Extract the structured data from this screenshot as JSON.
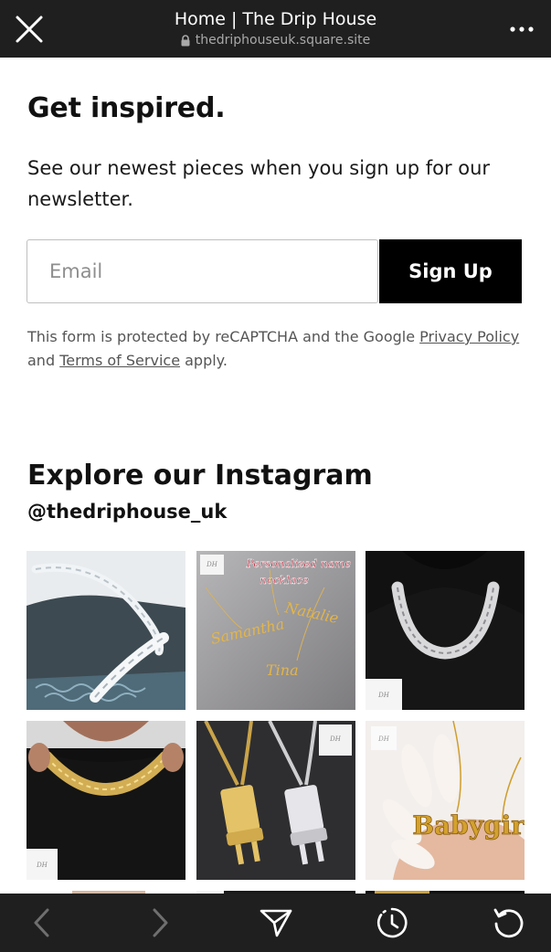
{
  "browser": {
    "title": "Home | The Drip House",
    "url": "thedriphouseuk.square.site",
    "icons": {
      "close": "close-icon",
      "lock": "lock-icon",
      "more": "more-icon"
    }
  },
  "newsletter": {
    "heading": "Get inspired.",
    "description": "See our newest pieces when you sign up for our newsletter.",
    "email_placeholder": "Email",
    "email_value": "",
    "signup_label": "Sign Up",
    "legal": {
      "prefix": "This form is protected by reCAPTCHA and the Google ",
      "privacy_link": "Privacy Policy",
      "middle": " and ",
      "terms_link": "Terms of Service",
      "suffix": " apply."
    }
  },
  "instagram": {
    "heading": "Explore our Instagram",
    "handle": "@thedriphouse_uk",
    "posts": [
      {
        "name": "silver-cuban-chain-post"
      },
      {
        "name": "personalized-name-necklace-post",
        "caption": "Personalized name necklace",
        "names": [
          "Samantha",
          "Natalie",
          "Tina"
        ],
        "watermark": "DH"
      },
      {
        "name": "iced-cuban-chain-bust-post",
        "watermark": "DH"
      },
      {
        "name": "gold-chain-worn-post",
        "watermark": "DH"
      },
      {
        "name": "plug-pendant-chains-post",
        "watermark": "DH"
      },
      {
        "name": "babygirl-necklace-post",
        "text": "Babygirl",
        "watermark": "DH"
      }
    ]
  },
  "toolbar": {
    "icons": [
      "back-icon",
      "forward-icon",
      "share-icon",
      "history-icon",
      "refresh-icon"
    ]
  },
  "colors": {
    "browser_bar": "#1f1f1f",
    "button_black": "#000000",
    "text_primary": "#111111",
    "text_muted": "#555555",
    "gold": "#d4a52c",
    "silver": "#dcdcdc"
  }
}
